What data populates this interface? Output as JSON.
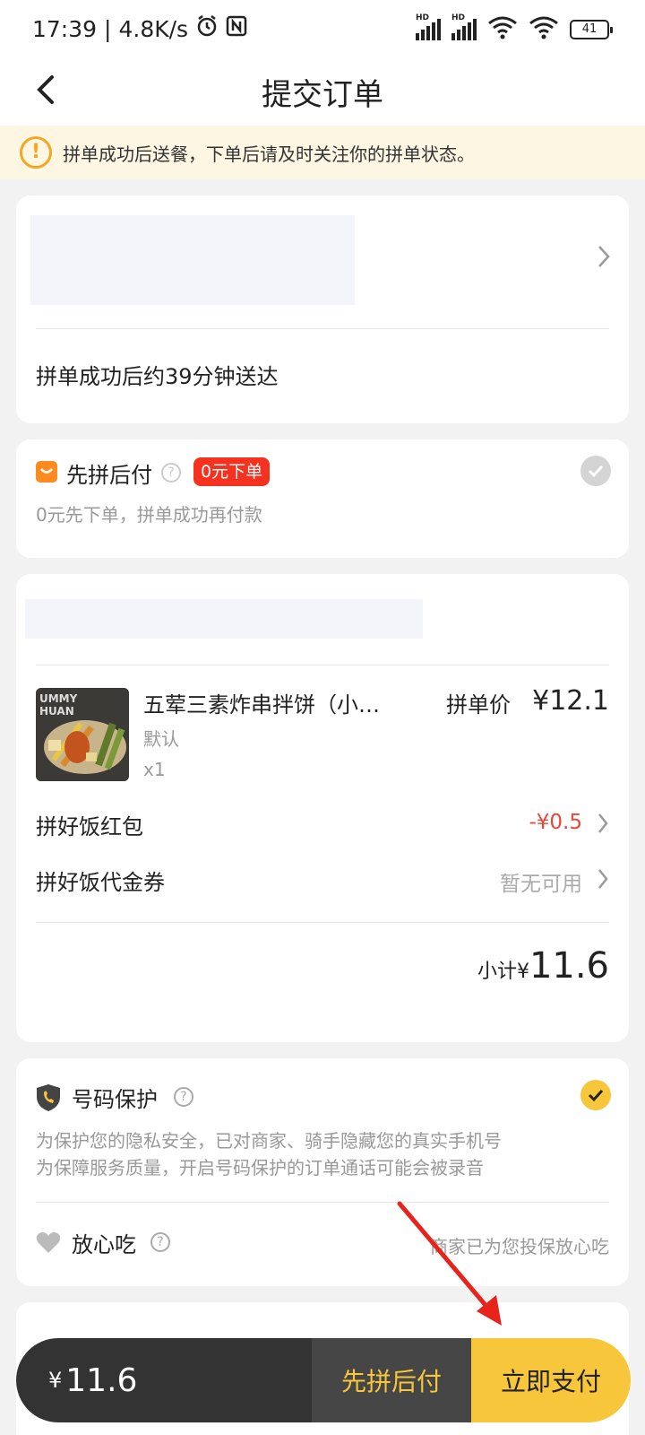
{
  "status_bar": {
    "time": "17:39",
    "speed": "4.8K/s",
    "battery": "41"
  },
  "nav": {
    "title": "提交订单"
  },
  "notice": {
    "text": "拼单成功后送餐，下单后请及时关注你的拼单状态。"
  },
  "delivery": {
    "eta_text": "拼单成功后约39分钟送达"
  },
  "pay_later": {
    "title": "先拼后付",
    "badge": "0元下单",
    "desc": "0元先下单，拼单成功再付款"
  },
  "order": {
    "item": {
      "name": "五荤三素炸串拌饼（小…",
      "spec": "默认",
      "qty": "x1",
      "price_label": "拼单价",
      "price": "¥12.1"
    },
    "red_packet": {
      "label": "拼好饭红包",
      "value": "-¥0.5"
    },
    "voucher": {
      "label": "拼好饭代金券",
      "value": "暂无可用"
    },
    "subtotal_label": "小计¥",
    "subtotal_value": "11.6"
  },
  "privacy": {
    "title": "号码保护",
    "line1": "为保护您的隐私安全，已对商家、骑手隐藏您的真实手机号",
    "line2": "为保障服务质量，开启号码保护的订单通话可能会被录音"
  },
  "safe_eat": {
    "title": "放心吃",
    "desc": "商家已为您投保放心吃"
  },
  "bottom_bar": {
    "currency": "¥",
    "total": "11.6",
    "pay_later_label": "先拼后付",
    "pay_now_label": "立即支付"
  },
  "colors": {
    "accent_yellow": "#f7c63b",
    "badge_red": "#f5311f",
    "discount_red": "#e8473a",
    "warning_orange": "#f5a623"
  }
}
